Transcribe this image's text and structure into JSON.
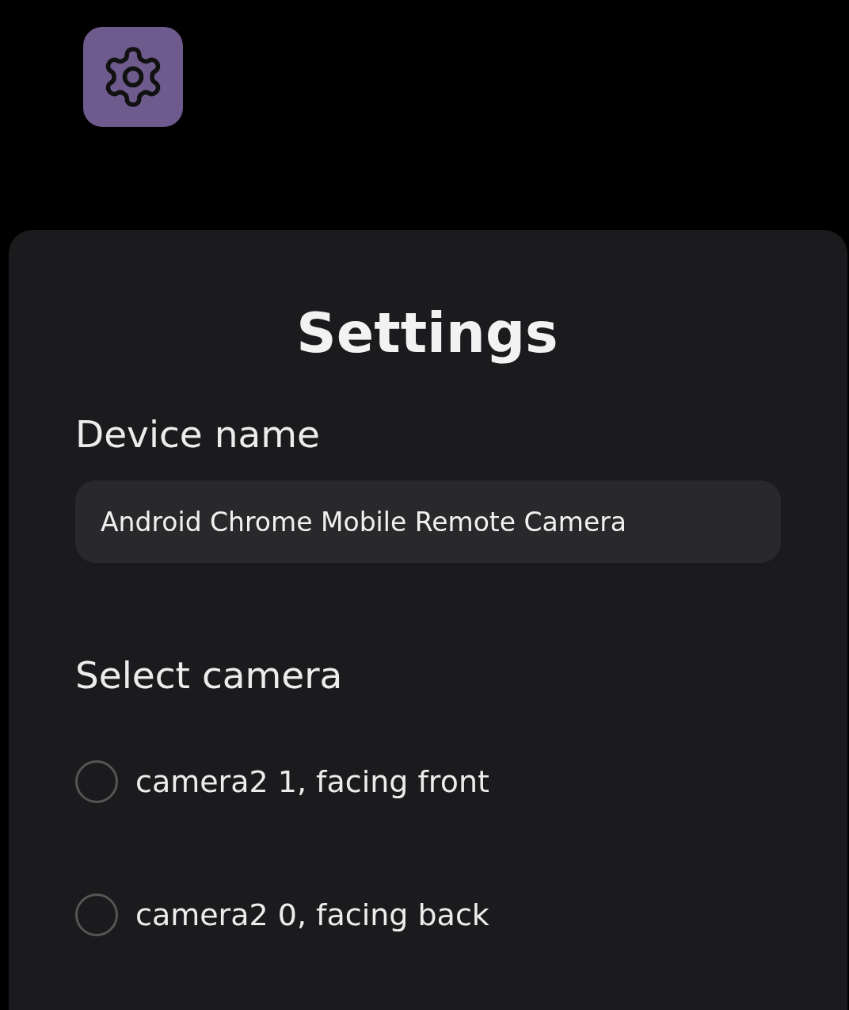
{
  "title": "Settings",
  "device_name": {
    "label": "Device name",
    "value": "Android Chrome Mobile Remote Camera"
  },
  "camera": {
    "label": "Select camera",
    "options": [
      {
        "label": "camera2 1, facing front",
        "selected": false
      },
      {
        "label": "camera2 0, facing back",
        "selected": false
      }
    ]
  }
}
